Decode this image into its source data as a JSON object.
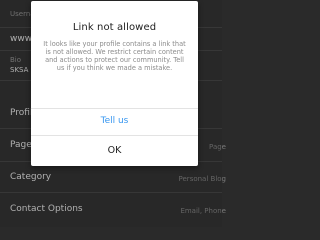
{
  "background": {
    "field_name_label": "Username",
    "field_website_value": "www.r",
    "field_bio_label": "Bio",
    "field_bio_value": "SKSA R",
    "profile_label": "Profile",
    "page_label": "Page",
    "page_value": "Page",
    "category_label": "Category",
    "category_value": "Personal Blog",
    "contact_label": "Contact Options",
    "contact_value": "Email, Phone"
  },
  "dialog": {
    "title": "Link not allowed",
    "message": "It looks like your profile contains a link that is not allowed. We restrict certain content and actions to protect our community. Tell us if you think we made a mistake.",
    "tell_us_label": "Tell us",
    "ok_label": "OK"
  },
  "colors": {
    "accent": "#3897f0",
    "background": "#313131",
    "dialog_bg": "#ffffff"
  }
}
